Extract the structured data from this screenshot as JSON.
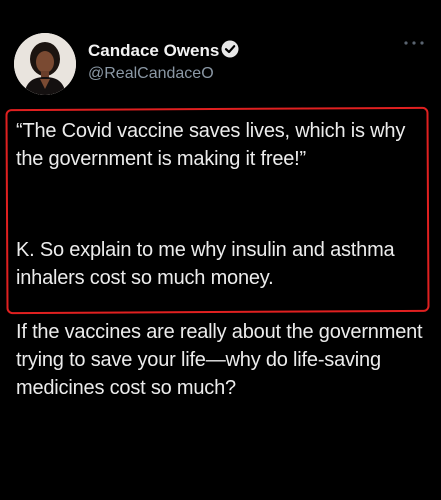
{
  "author": {
    "name": "Candace Owens",
    "handle": "@RealCandaceO",
    "verified": true
  },
  "menu": {
    "icon": "more-dots-icon"
  },
  "tweet": {
    "paragraphs": [
      "“The Covid vaccine saves lives, which is why the government is making it free!”",
      "K. So explain to me why insulin and asthma inhalers cost so much money.",
      "If the vaccines are really about the government trying to save your life—why do life-saving medicines cost so much?"
    ]
  },
  "colors": {
    "background": "#000000",
    "text": "#ececec",
    "handle": "#8b98a5",
    "highlight_border": "#e02020",
    "verified_badge": "#1d9bf0"
  }
}
